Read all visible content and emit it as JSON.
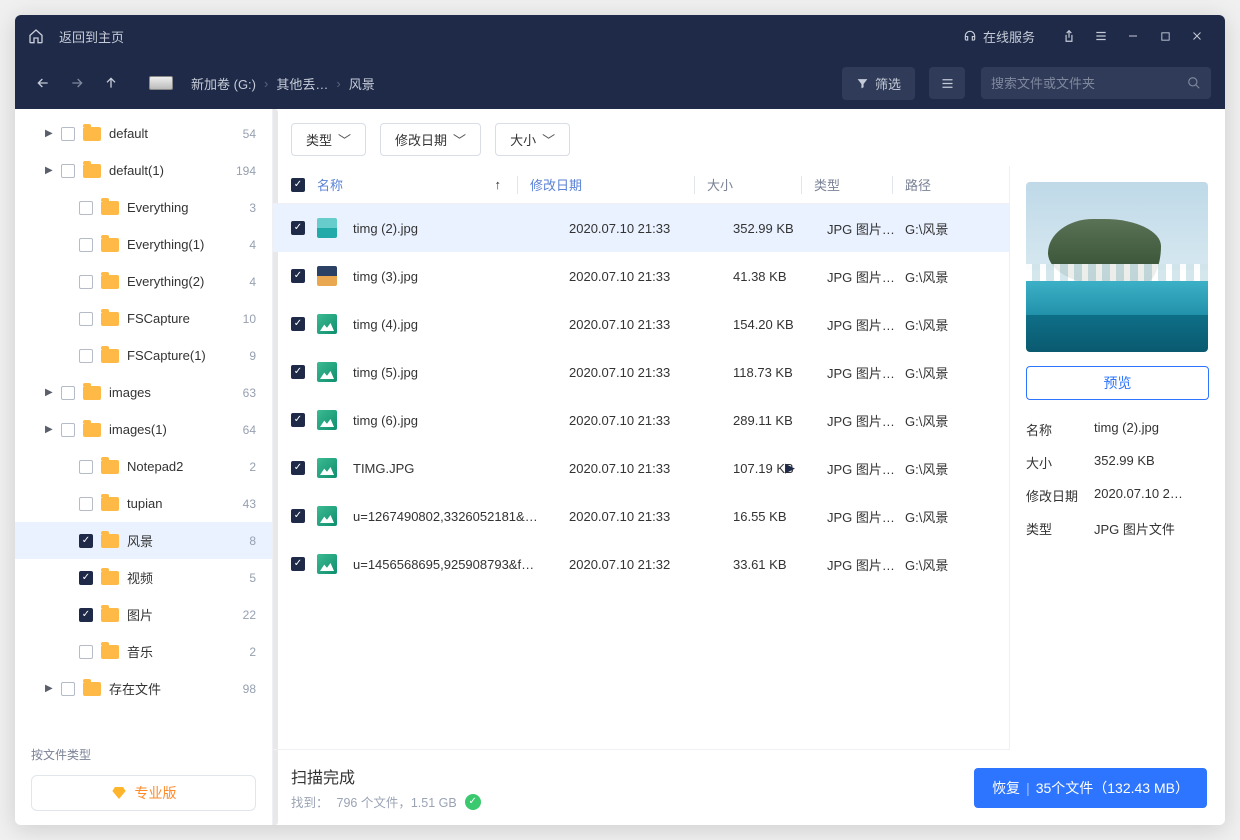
{
  "titlebar": {
    "back_home": "返回到主页",
    "online_service": "在线服务"
  },
  "breadcrumb": {
    "drive": "新加卷 (G:)",
    "folder1": "其他丢…",
    "folder2": "风景"
  },
  "toolbar": {
    "filter": "筛选",
    "search_placeholder": "搜索文件或文件夹"
  },
  "chips": {
    "type": "类型",
    "date": "修改日期",
    "size": "大小"
  },
  "sidebar": {
    "items": [
      {
        "label": "default",
        "count": "54",
        "checked": false,
        "arrow": true,
        "indent": 1
      },
      {
        "label": "default(1)",
        "count": "194",
        "checked": false,
        "arrow": true,
        "indent": 1
      },
      {
        "label": "Everything",
        "count": "3",
        "checked": false,
        "arrow": false,
        "indent": 2
      },
      {
        "label": "Everything(1)",
        "count": "4",
        "checked": false,
        "arrow": false,
        "indent": 2
      },
      {
        "label": "Everything(2)",
        "count": "4",
        "checked": false,
        "arrow": false,
        "indent": 2
      },
      {
        "label": "FSCapture",
        "count": "10",
        "checked": false,
        "arrow": false,
        "indent": 2
      },
      {
        "label": "FSCapture(1)",
        "count": "9",
        "checked": false,
        "arrow": false,
        "indent": 2
      },
      {
        "label": "images",
        "count": "63",
        "checked": false,
        "arrow": true,
        "indent": 1
      },
      {
        "label": "images(1)",
        "count": "64",
        "checked": false,
        "arrow": true,
        "indent": 1
      },
      {
        "label": "Notepad2",
        "count": "2",
        "checked": false,
        "arrow": false,
        "indent": 2
      },
      {
        "label": "tupian",
        "count": "43",
        "checked": false,
        "arrow": false,
        "indent": 2
      },
      {
        "label": "风景",
        "count": "8",
        "checked": true,
        "arrow": false,
        "indent": 2,
        "selected": true
      },
      {
        "label": "视频",
        "count": "5",
        "checked": true,
        "arrow": false,
        "indent": 2
      },
      {
        "label": "图片",
        "count": "22",
        "checked": true,
        "arrow": false,
        "indent": 2
      },
      {
        "label": "音乐",
        "count": "2",
        "checked": false,
        "arrow": false,
        "indent": 2
      },
      {
        "label": "存在文件",
        "count": "98",
        "checked": false,
        "arrow": true,
        "indent": 1
      }
    ],
    "by_type": "按文件类型",
    "pro": "专业版"
  },
  "table": {
    "headers": {
      "name": "名称",
      "date": "修改日期",
      "size": "大小",
      "type": "类型",
      "path": "路径"
    },
    "rows": [
      {
        "name": "timg (2).jpg",
        "date": "2020.07.10 21:33",
        "size": "352.99 KB",
        "type": "JPG 图片…",
        "path": "G:\\风景",
        "thumb": "photo1",
        "selected": true,
        "arrow": false
      },
      {
        "name": "timg (3).jpg",
        "date": "2020.07.10 21:33",
        "size": "41.38 KB",
        "type": "JPG 图片…",
        "path": "G:\\风景",
        "thumb": "photo2",
        "selected": false,
        "arrow": false
      },
      {
        "name": "timg (4).jpg",
        "date": "2020.07.10 21:33",
        "size": "154.20 KB",
        "type": "JPG 图片…",
        "path": "G:\\风景",
        "thumb": "gen-jpg",
        "selected": false,
        "arrow": false
      },
      {
        "name": "timg (5).jpg",
        "date": "2020.07.10 21:33",
        "size": "118.73 KB",
        "type": "JPG 图片…",
        "path": "G:\\风景",
        "thumb": "gen-jpg",
        "selected": false,
        "arrow": false
      },
      {
        "name": "timg (6).jpg",
        "date": "2020.07.10 21:33",
        "size": "289.11 KB",
        "type": "JPG 图片…",
        "path": "G:\\风景",
        "thumb": "gen-jpg",
        "selected": false,
        "arrow": false
      },
      {
        "name": "TIMG.JPG",
        "date": "2020.07.10 21:33",
        "size": "107.19 KB",
        "type": "JPG 图片…",
        "path": "G:\\风景",
        "thumb": "gen-jpg",
        "selected": false,
        "arrow": true
      },
      {
        "name": "u=1267490802,3326052181&…",
        "date": "2020.07.10 21:33",
        "size": "16.55 KB",
        "type": "JPG 图片…",
        "path": "G:\\风景",
        "thumb": "gen-jpg",
        "selected": false,
        "arrow": false
      },
      {
        "name": "u=1456568695,925908793&f…",
        "date": "2020.07.10 21:32",
        "size": "33.61 KB",
        "type": "JPG 图片…",
        "path": "G:\\风景",
        "thumb": "gen-jpg",
        "selected": false,
        "arrow": false
      }
    ]
  },
  "status": {
    "title": "扫描完成",
    "found_prefix": "找到：",
    "found": "796 个文件，1.51 GB",
    "recover_label": "恢复",
    "recover_detail": "35个文件（132.43 MB）"
  },
  "preview": {
    "button": "预览",
    "meta": {
      "name_k": "名称",
      "name_v": "timg (2).jpg",
      "size_k": "大小",
      "size_v": "352.99 KB",
      "date_k": "修改日期",
      "date_v": "2020.07.10 2…",
      "type_k": "类型",
      "type_v": "JPG 图片文件"
    }
  }
}
